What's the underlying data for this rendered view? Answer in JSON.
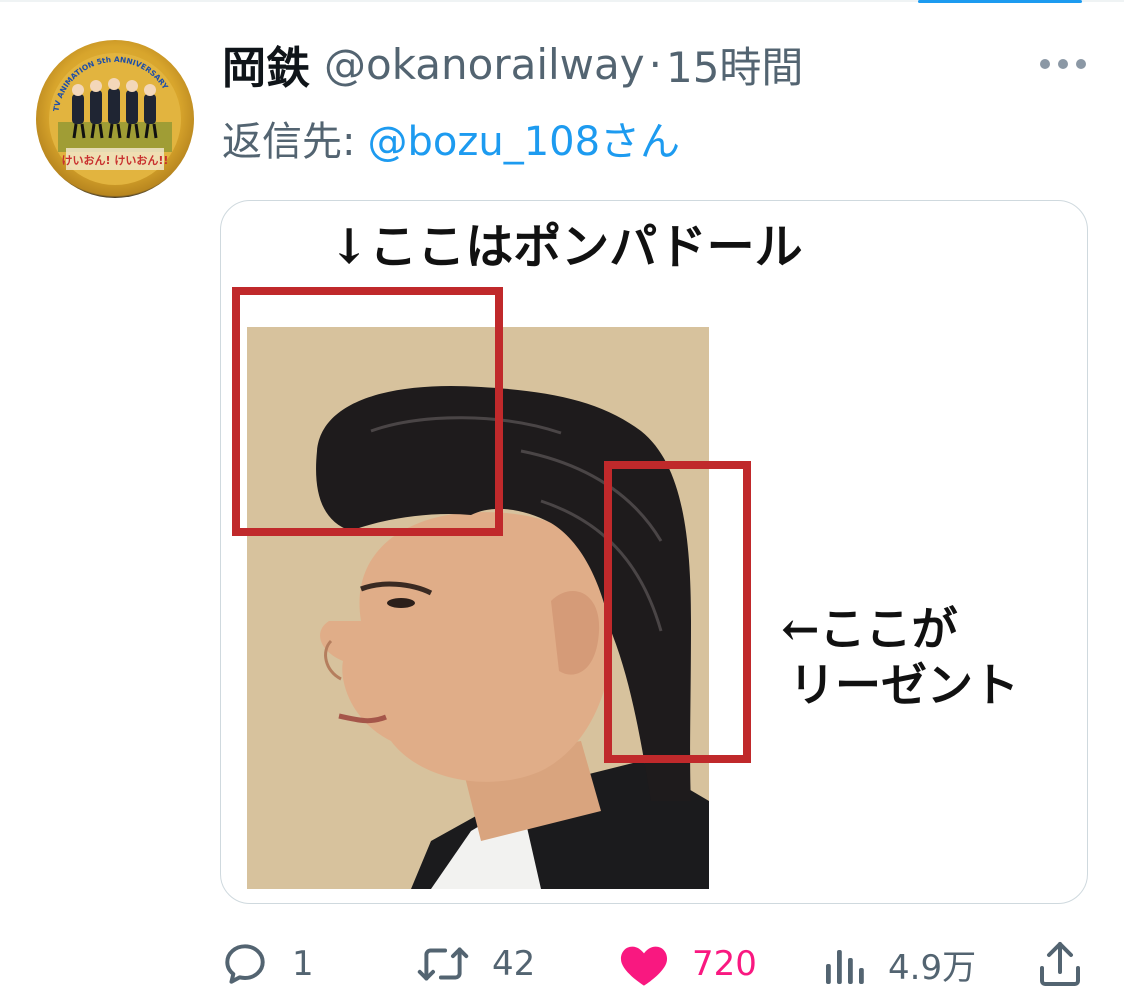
{
  "tweet": {
    "author_name": "岡鉄",
    "handle": "@okanorailway",
    "separator": "·",
    "time": "15時間",
    "reply_prefix": "返信先:",
    "reply_to": "@bozu_108さん"
  },
  "avatar": {
    "ring_text": "TV ANIMATION 5th ANNIVERSARY",
    "badge_text": "けいおん! けいおん!!"
  },
  "media": {
    "label_top": "↓ここはポンパドール",
    "label_side_line1": "←ここが",
    "label_side_line2": "リーゼント"
  },
  "actions": {
    "replies": "1",
    "retweets": "42",
    "likes": "720",
    "views": "4.9万"
  },
  "colors": {
    "accent": "#1d9bf0",
    "like": "#f91880",
    "muted": "#536471",
    "highlight_box": "#c0292b"
  },
  "icons": {
    "reply": "reply-icon",
    "retweet": "retweet-icon",
    "like": "heart-icon",
    "views": "views-icon",
    "share": "share-icon",
    "more": "more-icon"
  }
}
